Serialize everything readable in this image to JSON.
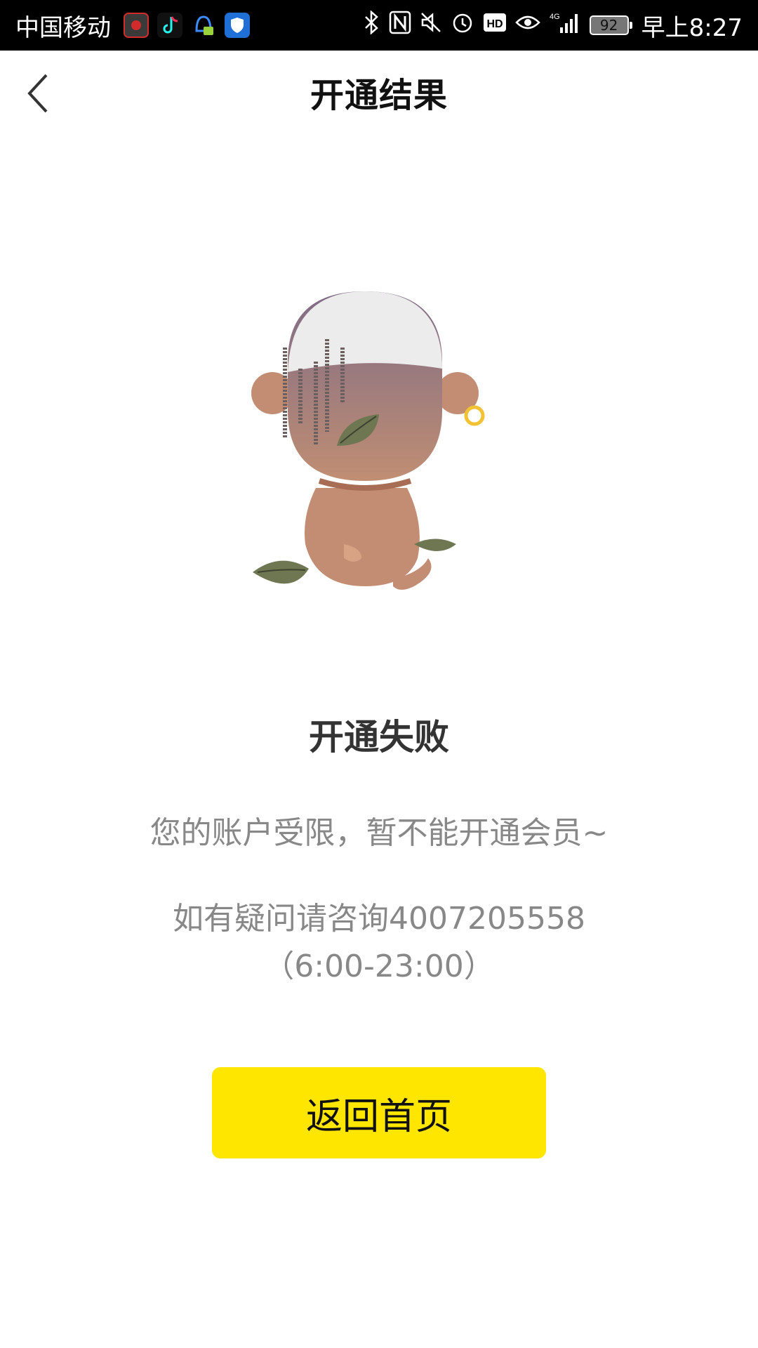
{
  "status_bar": {
    "carrier": "中国移动",
    "battery": "92",
    "time": "早上8:27",
    "icons": [
      "weibo-icon",
      "tiktok-icon",
      "qq-icon",
      "shield-icon",
      "bluetooth-icon",
      "nfc-icon",
      "mute-icon",
      "alarm-icon",
      "hd-icon",
      "eye-icon",
      "signal-4g-icon",
      "battery-icon"
    ]
  },
  "header": {
    "title": "开通结果",
    "back_icon": "chevron-left-icon"
  },
  "result": {
    "title": "开通失败",
    "message": "您的账户受限，暂不能开通会员~",
    "contact": "如有疑问请咨询4007205558（6:00-23:00）"
  },
  "button": {
    "label": "返回首页",
    "color": "#ffe600"
  },
  "illustration": {
    "name": "dejected-cartoon-character"
  }
}
